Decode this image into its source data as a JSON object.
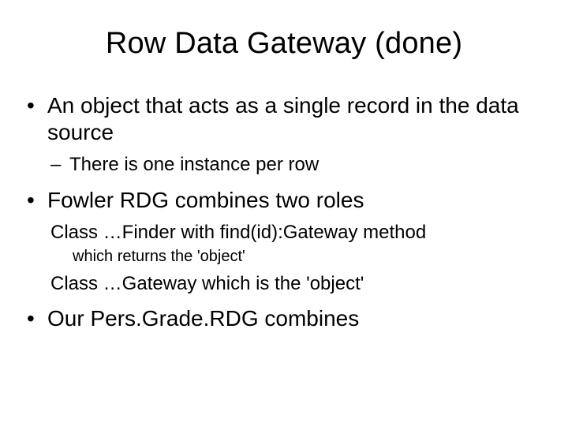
{
  "slide": {
    "title": "Row Data Gateway (done)",
    "b1": "An object that acts as a single record in the data source",
    "b1_sub1": "There is one instance per row",
    "b2": "Fowler RDG combines two roles",
    "b2_sub1": "Class …Finder with find(id):Gateway method",
    "b2_sub1_sub": "which returns the 'object'",
    "b2_sub2": "Class …Gateway which is the 'object'",
    "b3": "Our Pers.Grade.RDG combines"
  }
}
